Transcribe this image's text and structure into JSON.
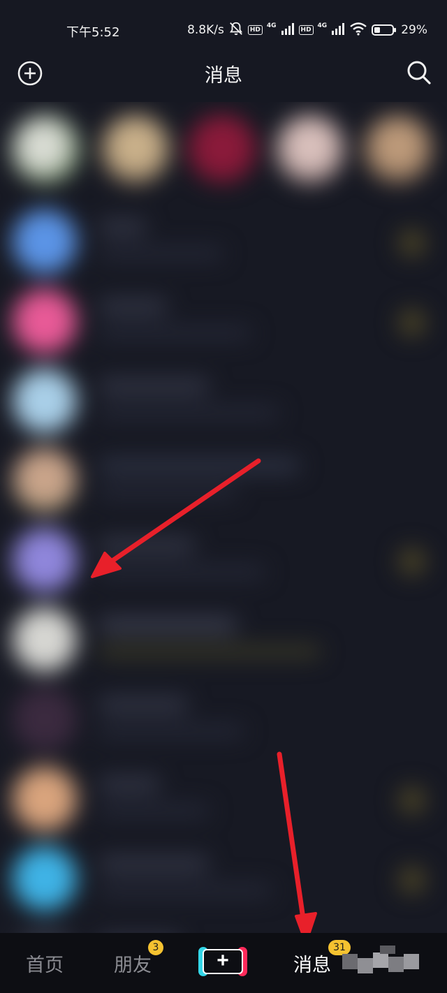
{
  "status_bar": {
    "time": "下午5:52",
    "net_speed": "8.8K/s",
    "hd_label": "HD",
    "network_label": "4G",
    "battery": "29%"
  },
  "header": {
    "title": "消息",
    "add_icon": "plus-circle-icon",
    "search_icon": "search-icon"
  },
  "bottom_nav": {
    "home_label": "首页",
    "friends_label": "朋友",
    "friends_badge": "3",
    "create_label": "+",
    "messages_label": "消息",
    "messages_badge": "31"
  },
  "colors": {
    "background": "#161822",
    "nav_background": "#0d0e13",
    "badge": "#f5c230",
    "annotation_arrow": "#e8202a",
    "create_cyan": "#33d6e8",
    "create_red": "#ff2a5a"
  }
}
